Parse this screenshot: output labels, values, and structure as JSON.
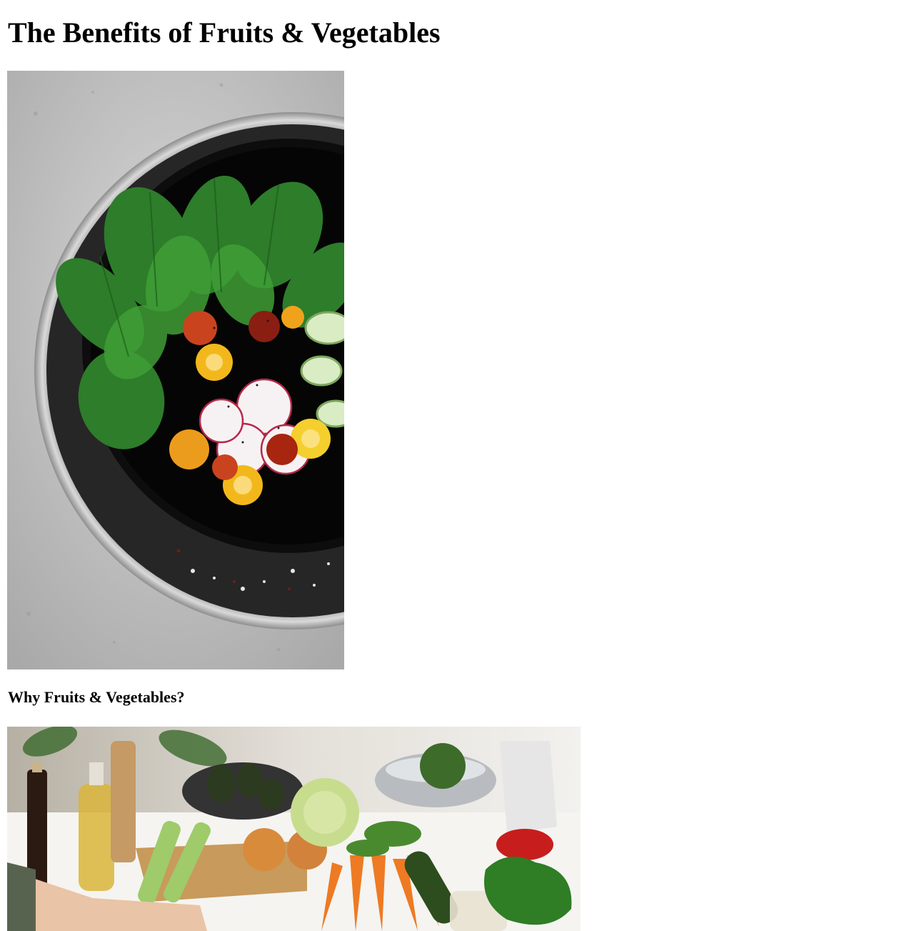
{
  "page": {
    "title": "The Benefits of Fruits & Vegetables",
    "section_heading": "Why Fruits & Vegetables?"
  },
  "images": [
    {
      "name": "salad-bowl-photo",
      "subject": "bowl of spinach, tomatoes, radishes and cucumber"
    },
    {
      "name": "vegetables-kitchen-photo",
      "subject": "fresh vegetables on a kitchen table"
    }
  ],
  "colors": {
    "background": "#ffffff",
    "text": "#000000"
  }
}
